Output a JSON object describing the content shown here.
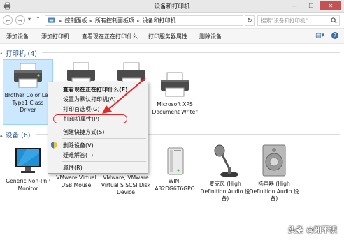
{
  "window": {
    "title": "设备和打印机",
    "minimize": "—",
    "maximize": "☐",
    "close": "✕"
  },
  "address": {
    "back": "←",
    "forward": "→",
    "up": "↑",
    "breadcrumb": [
      "控制面板",
      "所有控制面板项",
      "设备和打印机"
    ],
    "refresh": "↻",
    "search_placeholder": "搜索\"设备和打印机\""
  },
  "commands": [
    "添加设备",
    "添加打印机",
    "查看现在正在打印什么",
    "打印服务器属性",
    "删除设备"
  ],
  "printers_group": {
    "title": "打印机 (4)",
    "items": [
      {
        "label": "Brother Color Leg Type1 Class Driver",
        "selected": true
      },
      {
        "label": ""
      },
      {
        "label": ""
      },
      {
        "label": "Microsoft XPS Document Writer"
      }
    ]
  },
  "devices_group": {
    "title": "设备 (6)",
    "items": [
      {
        "label": "Generic Non-PnP Monitor",
        "icon": "monitor-icon"
      },
      {
        "label": "VMware Virtual USB Mouse",
        "icon": "mouse-icon"
      },
      {
        "label": "VMware, VMware Virtual S SCSI Disk Device",
        "icon": "disk-icon"
      },
      {
        "label": "WIN-A32DG6T6GPO",
        "icon": "computer-icon"
      },
      {
        "label": "麦克风 (High Definition Audio 设备)",
        "icon": "microphone-icon"
      },
      {
        "label": "扬声器 (High Definition Audio 设备)",
        "icon": "speaker-icon"
      }
    ]
  },
  "context_menu": {
    "items": [
      {
        "label": "查看现在正在打印什么(E)",
        "bold": true
      },
      {
        "label": "设置为默认打印机(A)"
      },
      {
        "label": "打印首选项(G)"
      },
      {
        "label": "打印机属性(P)",
        "highlighted": true
      },
      {
        "label": "创建快捷方式(S)"
      },
      {
        "label": "删除设备(V)"
      },
      {
        "label": "疑难解答(T)"
      },
      {
        "label": "属性(R)"
      }
    ]
  },
  "watermark": "头条 @知不识",
  "colors": {
    "accent": "#1e4e8c",
    "annotation": "#e02828",
    "selection": "#cce8ff"
  }
}
